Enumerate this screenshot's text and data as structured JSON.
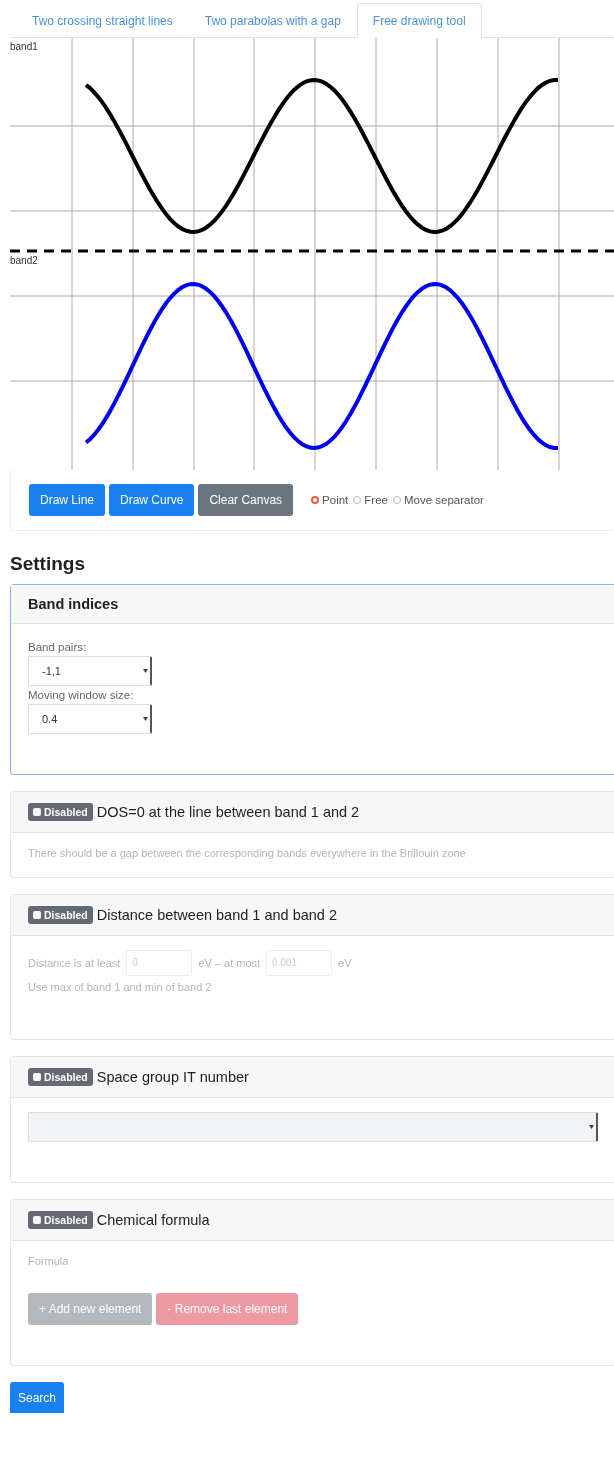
{
  "tabs": [
    {
      "label": "Two crossing straight lines",
      "selected": false
    },
    {
      "label": "Two parabolas with a gap",
      "selected": false
    },
    {
      "label": "Free drawing tool",
      "selected": true
    }
  ],
  "canvas": {
    "bands": [
      {
        "label": "band1",
        "color": "#000000"
      },
      {
        "label": "band2",
        "color": "#0000ee"
      }
    ]
  },
  "toolbar": {
    "buttons": [
      {
        "label": "Draw Line",
        "kind": "primary"
      },
      {
        "label": "Draw Curve",
        "kind": "primary"
      },
      {
        "label": "Clear Canvas",
        "kind": "secondary"
      }
    ],
    "modes": [
      {
        "label": "Point",
        "selected": true
      },
      {
        "label": "Free",
        "selected": false
      },
      {
        "label": "Move separator",
        "selected": false
      }
    ]
  },
  "settings": {
    "heading": "Settings",
    "sections": [
      {
        "kind": "fields",
        "title": "Band indices",
        "focused": true,
        "fields": [
          {
            "label": "Band pairs:",
            "value": "-1,1"
          },
          {
            "label": "Moving window size:",
            "value": "0.4"
          }
        ]
      },
      {
        "kind": "text",
        "title": "DOS=0 at the line between band 1 and 2",
        "toggle": {
          "label": "Disabled",
          "checked": false
        },
        "text": "There should be a gap between the corresponding bands everywhere in the Brillouin zone"
      },
      {
        "kind": "range",
        "title": "Distance between band 1 and band 2",
        "toggle": {
          "label": "Disabled",
          "checked": false
        },
        "prefix": "Distance is at least",
        "min": "0",
        "middle": "eV – at most",
        "max": "0.001",
        "suffix": "eV",
        "note": "Use max of band 1 and min of band 2"
      },
      {
        "kind": "select",
        "title": "Space group IT number",
        "toggle": {
          "label": "Disabled",
          "checked": false
        }
      },
      {
        "kind": "formula",
        "title": "Chemical formula",
        "toggle": {
          "label": "Disabled",
          "checked": false
        },
        "label": "Formula",
        "buttons": [
          {
            "label": "+ Add new element",
            "kind": "secondary"
          },
          {
            "label": "- Remove last element",
            "kind": "danger"
          }
        ]
      }
    ]
  },
  "search_button": "Search"
}
